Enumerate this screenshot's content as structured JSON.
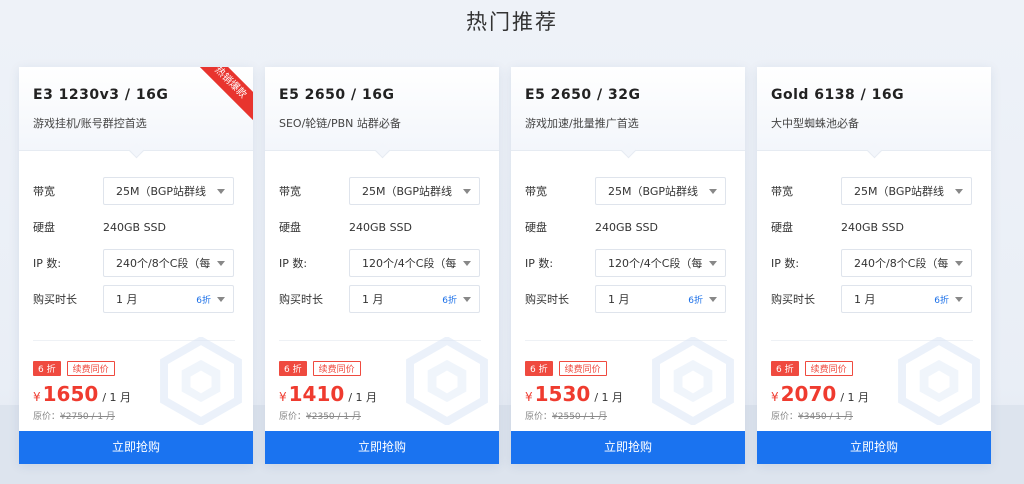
{
  "section_title": "热门推荐",
  "colors": {
    "accent": "#1a73f0",
    "price": "#ef3b2f",
    "ribbon": "#e8342e"
  },
  "icons": {
    "select": "chevron-down-icon",
    "decoration": "hexagon-icon"
  },
  "cards": [
    {
      "title": "E3 1230v3 / 16G",
      "subtitle": "游戏挂机/账号群控首选",
      "ribbon": "热销爆款",
      "bandwidth_label": "带宽",
      "bandwidth_value": "25M（BGP站群线",
      "disk_label": "硬盘",
      "disk_value": "240GB SSD",
      "ip_label": "IP 数:",
      "ip_value": "240个/8个C段（每",
      "duration_label": "购买时长",
      "duration_value": "1 月",
      "duration_discount": "6折",
      "tag_discount": "6 折",
      "tag_renew": "续费同价",
      "currency": "¥",
      "price": "1650",
      "per": "/ 1 月",
      "orig_prefix": "原价：",
      "orig_price": "¥2750 / 1 月",
      "buy_label": "立即抢购"
    },
    {
      "title": "E5 2650 / 16G",
      "subtitle": "SEO/轮链/PBN 站群必备",
      "ribbon": "",
      "bandwidth_label": "带宽",
      "bandwidth_value": "25M（BGP站群线",
      "disk_label": "硬盘",
      "disk_value": "240GB SSD",
      "ip_label": "IP 数:",
      "ip_value": "120个/4个C段（每",
      "duration_label": "购买时长",
      "duration_value": "1 月",
      "duration_discount": "6折",
      "tag_discount": "6 折",
      "tag_renew": "续费同价",
      "currency": "¥",
      "price": "1410",
      "per": "/ 1 月",
      "orig_prefix": "原价：",
      "orig_price": "¥2350 / 1 月",
      "buy_label": "立即抢购"
    },
    {
      "title": "E5 2650 / 32G",
      "subtitle": "游戏加速/批量推广首选",
      "ribbon": "",
      "bandwidth_label": "带宽",
      "bandwidth_value": "25M（BGP站群线",
      "disk_label": "硬盘",
      "disk_value": "240GB SSD",
      "ip_label": "IP 数:",
      "ip_value": "120个/4个C段（每",
      "duration_label": "购买时长",
      "duration_value": "1 月",
      "duration_discount": "6折",
      "tag_discount": "6 折",
      "tag_renew": "续费同价",
      "currency": "¥",
      "price": "1530",
      "per": "/ 1 月",
      "orig_prefix": "原价：",
      "orig_price": "¥2550 / 1 月",
      "buy_label": "立即抢购"
    },
    {
      "title": "Gold 6138 / 16G",
      "subtitle": "大中型蜘蛛池必备",
      "ribbon": "",
      "bandwidth_label": "带宽",
      "bandwidth_value": "25M（BGP站群线",
      "disk_label": "硬盘",
      "disk_value": "240GB SSD",
      "ip_label": "IP 数:",
      "ip_value": "240个/8个C段（每",
      "duration_label": "购买时长",
      "duration_value": "1 月",
      "duration_discount": "6折",
      "tag_discount": "6 折",
      "tag_renew": "续费同价",
      "currency": "¥",
      "price": "2070",
      "per": "/ 1 月",
      "orig_prefix": "原价：",
      "orig_price": "¥3450 / 1 月",
      "buy_label": "立即抢购"
    }
  ]
}
